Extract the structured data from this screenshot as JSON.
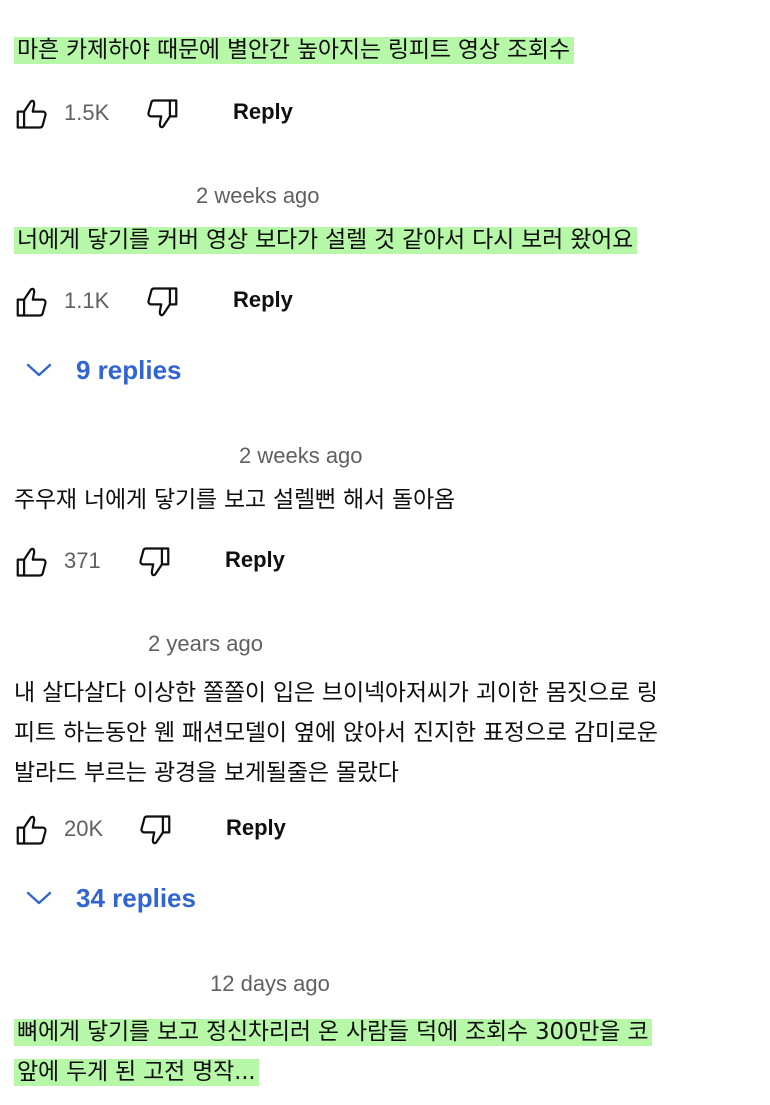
{
  "colors": {
    "highlight": "#b7f7a8",
    "link_blue": "#3165d4",
    "meta_gray": "#606060",
    "text": "#0f0f0f"
  },
  "icons": {
    "like": "thumbs-up-outline-icon",
    "dislike": "thumbs-down-outline-icon",
    "expand": "chevron-down-icon"
  },
  "comments": [
    {
      "timestamp": "",
      "text_lines": [
        "마흔 카제하야 때문에 별안간 높아지는 링피트 영상 조회수"
      ],
      "highlighted": true,
      "likes": "1.5K",
      "reply_label": "Reply",
      "replies_label": ""
    },
    {
      "timestamp": "2 weeks ago",
      "text_lines": [
        "너에게 닿기를 커버 영상 보다가 설렐 것 같아서 다시 보러 왔어요"
      ],
      "highlighted": true,
      "likes": "1.1K",
      "reply_label": "Reply",
      "replies_label": "9 replies"
    },
    {
      "timestamp": "2 weeks ago",
      "text_lines": [
        "주우재 너에게 닿기를 보고 설렐뻔 해서 돌아옴"
      ],
      "highlighted": false,
      "likes": "371",
      "reply_label": "Reply",
      "replies_label": ""
    },
    {
      "timestamp": "2 years ago",
      "text_lines": [
        "내 살다살다 이상한 쫄쫄이 입은 브이넥아저씨가 괴이한 몸짓으로 링",
        "피트 하는동안 웬 패션모델이 옆에 앉아서 진지한 표정으로 감미로운",
        "발라드 부르는 광경을 보게될줄은 몰랐다"
      ],
      "highlighted": false,
      "likes": "20K",
      "reply_label": "Reply",
      "replies_label": "34 replies"
    },
    {
      "timestamp": "12 days ago",
      "text_lines": [
        "뼈에게 닿기를 보고 정신차리러 온 사람들 덕에 조회수 300만을 코",
        "앞에 두게 된 고전 명작..."
      ],
      "highlighted": true,
      "likes": "",
      "reply_label": "",
      "replies_label": ""
    }
  ]
}
